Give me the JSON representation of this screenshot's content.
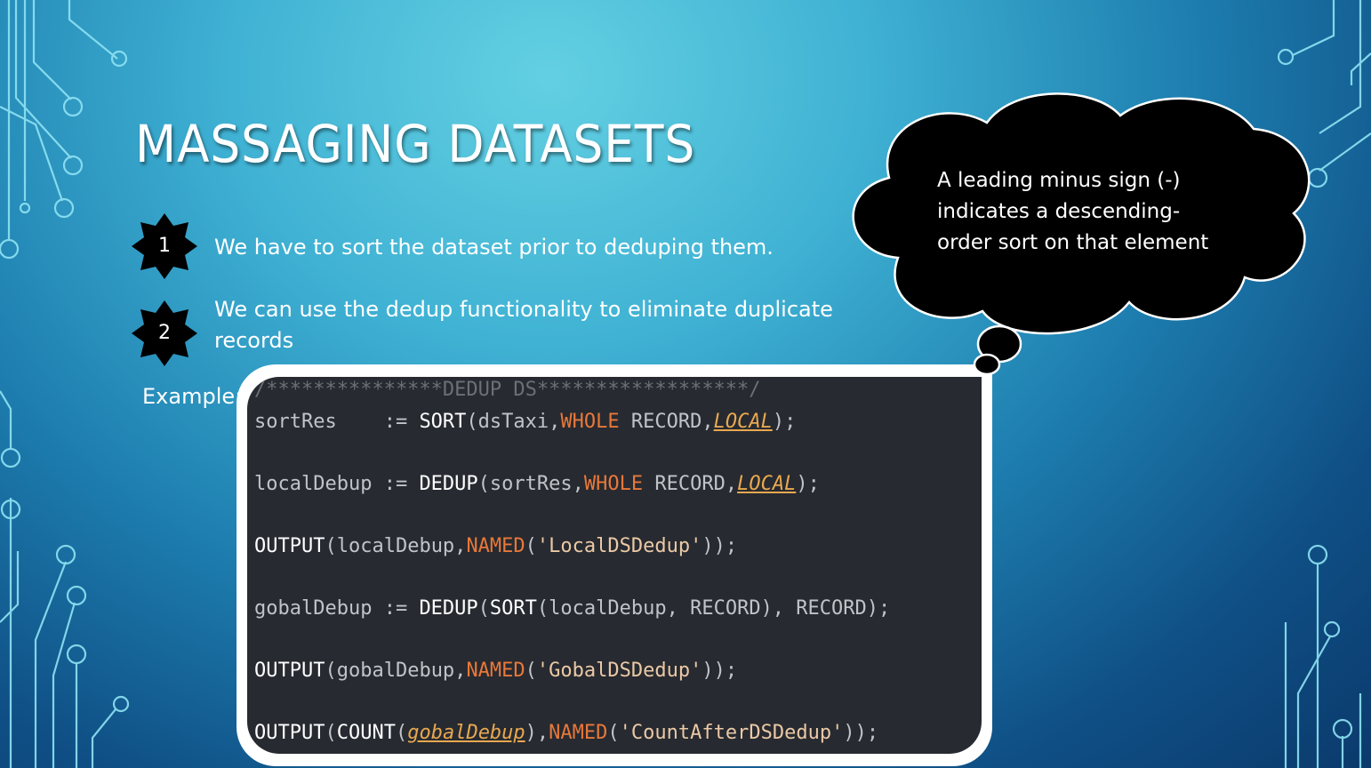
{
  "slide": {
    "title": "MASSAGING DATASETS",
    "bullets": [
      {
        "number": "1",
        "line1": "We have to sort the dataset prior to deduping them.",
        "line2": ""
      },
      {
        "number": "2",
        "line1": "We can use the dedup functionality to eliminate duplicate",
        "line2": "records"
      }
    ],
    "example_label": "Example:",
    "callout": {
      "line1": "A leading minus sign (-)",
      "line2": "indicates a descending-",
      "line3": "order sort on that element"
    }
  },
  "code": {
    "comment": "/***************DEDUP DS******************/",
    "l1": {
      "a": "sortRes    := ",
      "fn": "SORT",
      "b": "(dsTaxi,",
      "kw": "WHOLE",
      "c": " RECORD,",
      "loc": "LOCAL",
      "d": ");"
    },
    "l2": {
      "a": "localDebup := ",
      "fn": "DEDUP",
      "b": "(sortRes,",
      "kw": "WHOLE",
      "c": " RECORD,",
      "loc": "LOCAL",
      "d": ");"
    },
    "l3": {
      "fn": "OUTPUT",
      "a": "(localDebup,",
      "kw": "NAMED",
      "b": "(",
      "str": "'LocalDSDedup'",
      "c": "));"
    },
    "l4": {
      "a": "gobalDebup := ",
      "fn1": "DEDUP",
      "b": "(",
      "fn2": "SORT",
      "c": "(localDebup, RECORD), RECORD);"
    },
    "l5": {
      "fn": "OUTPUT",
      "a": "(gobalDebup,",
      "kw": "NAMED",
      "b": "(",
      "str": "'GobalDSDedup'",
      "c": "));"
    },
    "l6": {
      "fn1": "OUTPUT",
      "a": "(",
      "fn2": "COUNT",
      "b": "(",
      "loc": "gobalDebup",
      "c": "),",
      "kw": "NAMED",
      "d": "(",
      "str": "'CountAfterDSDedup'",
      "e": "));"
    }
  },
  "colors": {
    "background": "#2a8fbf",
    "code_background": "#272a30",
    "keyword_orange": "#e8783a",
    "string": "#ebc9a6"
  }
}
